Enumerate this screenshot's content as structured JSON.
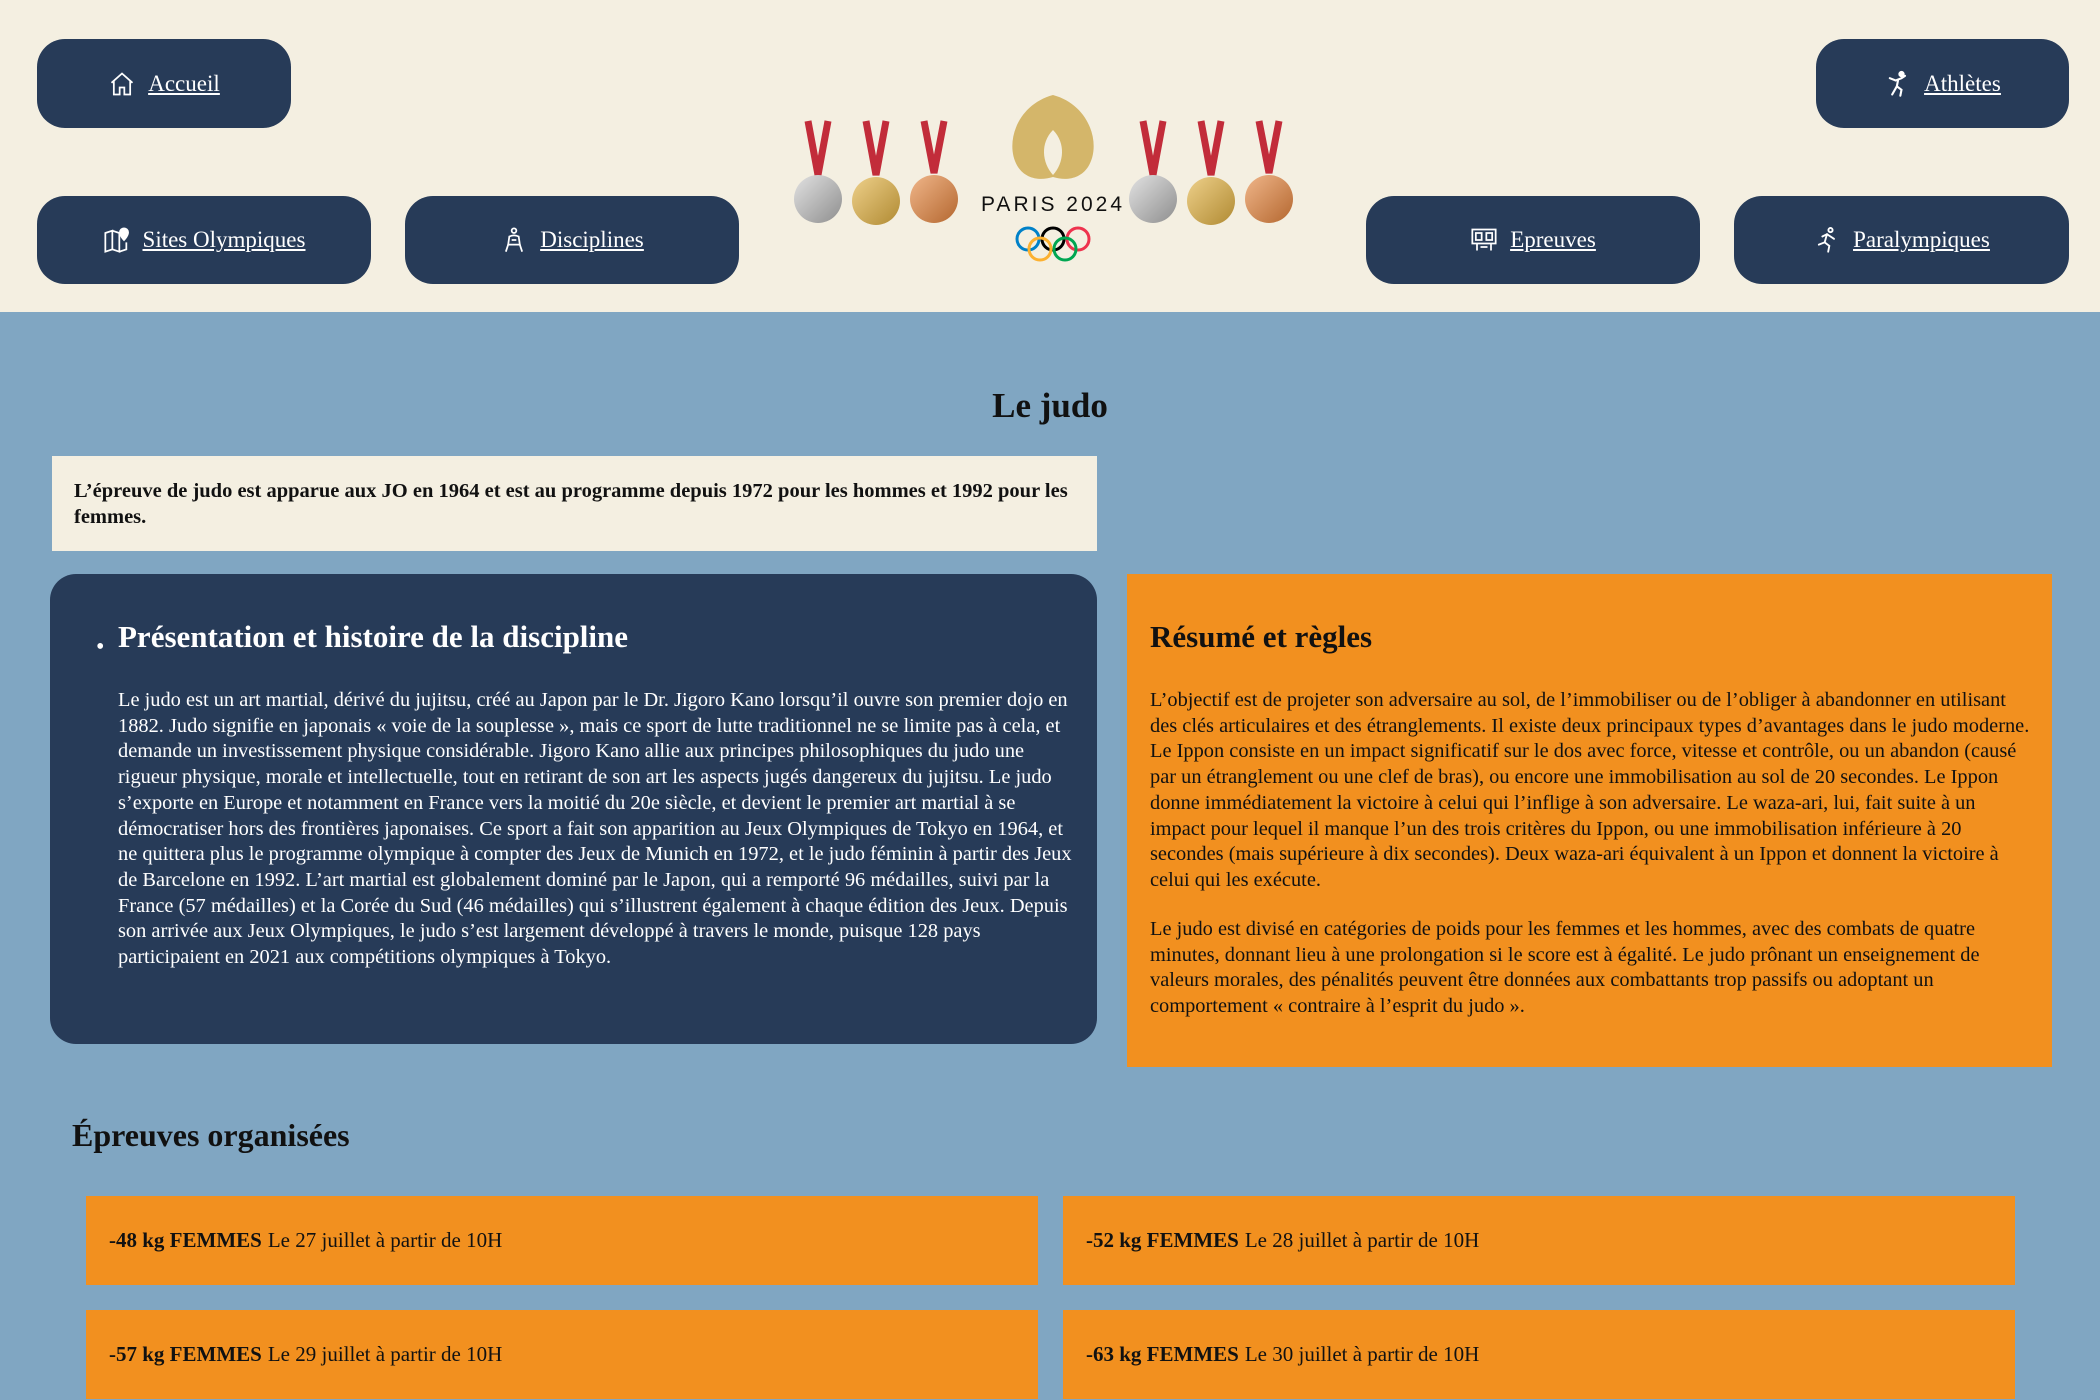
{
  "nav": {
    "accueil": "Accueil",
    "athletes": "Athlètes",
    "sites": "Sites Olympiques",
    "disciplines": "Disciplines",
    "epreuves": "Epreuves",
    "paralympiques": "Paralympiques"
  },
  "logo": {
    "text": "PARIS 2024"
  },
  "page": {
    "title": "Le judo",
    "intro": "L’épreuve de judo est apparue aux JO en 1964 et est au programme depuis 1972 pour les hommes et 1992 pour les femmes."
  },
  "history": {
    "title": "Présentation et histoire de la discipline",
    "text": "Le judo est un art martial, dérivé du jujitsu, créé au Japon par le Dr. Jigoro Kano lorsqu’il ouvre son premier dojo en 1882. Judo signifie en japonais « voie de la souplesse », mais ce sport de lutte traditionnel ne se limite pas à cela, et demande un investissement physique considérable. Jigoro Kano allie aux principes philosophiques du judo une rigueur physique, morale et intellectuelle, tout en retirant de son art les aspects jugés dangereux du jujitsu. Le judo s’exporte en Europe et notamment en France vers la moitié du 20e siècle, et devient le premier art martial à se démocratiser hors des frontières japonaises. Ce sport a fait son apparition au Jeux Olympiques de Tokyo en 1964, et ne quittera plus le programme olympique à compter des Jeux de Munich en 1972, et le judo féminin à partir des Jeux de Barcelone en 1992. L’art martial est globalement dominé par le Japon, qui a remporté 96 médailles, suivi par la France (57 médailles) et la Corée du Sud (46 médailles) qui s’illustrent également à chaque édition des Jeux. Depuis son arrivée aux Jeux Olympiques, le judo s’est largement développé à travers le monde, puisque 128 pays participaient en 2021 aux compétitions olympiques à Tokyo."
  },
  "rules": {
    "title": "Résumé et règles",
    "p1": "L’objectif est de projeter son adversaire au sol, de l’immobiliser ou de l’obliger à abandonner en utilisant des clés articulaires et des étranglements. Il existe deux principaux types d’avantages dans le judo moderne. Le Ippon consiste en un impact significatif sur le dos avec force, vitesse et contrôle, ou un abandon (causé par un étranglement ou une clef de bras), ou encore une immobilisation au sol de 20 secondes. Le Ippon donne immédiatement la victoire à celui qui l’inflige à son adversaire. Le waza-ari, lui, fait suite à un impact pour lequel il manque l’un des trois critères du Ippon, ou une immobilisation inférieure à 20 secondes (mais supérieure à dix secondes). Deux waza-ari équivalent à un Ippon et donnent la victoire à celui qui les exécute.",
    "p2": "Le judo est divisé en catégories de poids pour les femmes et les hommes, avec des combats de quatre minutes, donnant lieu à une prolongation si le score est à égalité. Le judo prônant un enseignement de valeurs morales, des pénalités peuvent être données aux combattants trop passifs ou adoptant un comportement « contraire à l’esprit du judo »."
  },
  "events": {
    "title": "Épreuves organisées",
    "items": [
      {
        "category": "-48 kg FEMMES",
        "date": "Le 27 juillet à partir de 10H"
      },
      {
        "category": "-52 kg FEMMES",
        "date": "Le 28 juillet à partir de 10H"
      },
      {
        "category": "-57 kg FEMMES",
        "date": "Le 29 juillet à partir de 10H"
      },
      {
        "category": "-63 kg FEMMES",
        "date": "Le 30 juillet à partir de 10H"
      }
    ]
  },
  "colors": {
    "navy": "#273b58",
    "cream": "#f4efe1",
    "orange": "#f2901f",
    "background": "#80a6c2",
    "gold": "#d4b66a"
  }
}
